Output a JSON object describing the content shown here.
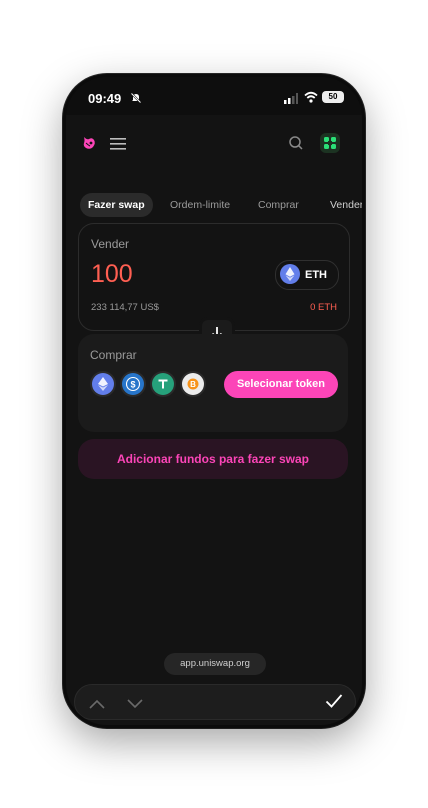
{
  "status": {
    "time": "09:49",
    "battery": "50"
  },
  "tabs": [
    "Fazer swap",
    "Ordem-limite",
    "Comprar",
    "Vender"
  ],
  "sell": {
    "label": "Vender",
    "amount": "100",
    "token": "ETH",
    "usd_value": "233 114,77 US$",
    "balance": "0 ETH"
  },
  "buy": {
    "label": "Comprar",
    "quick_tokens": [
      "eth-icon",
      "usdc-icon",
      "usdt-icon",
      "wbtc-icon"
    ],
    "select_label": "Selecionar token"
  },
  "add_funds_label": "Adicionar fundos para fazer swap",
  "url": "app.uniswap.org",
  "colors": {
    "accent": "#fc45b8",
    "error": "#ff5f52",
    "background": "#131313"
  }
}
